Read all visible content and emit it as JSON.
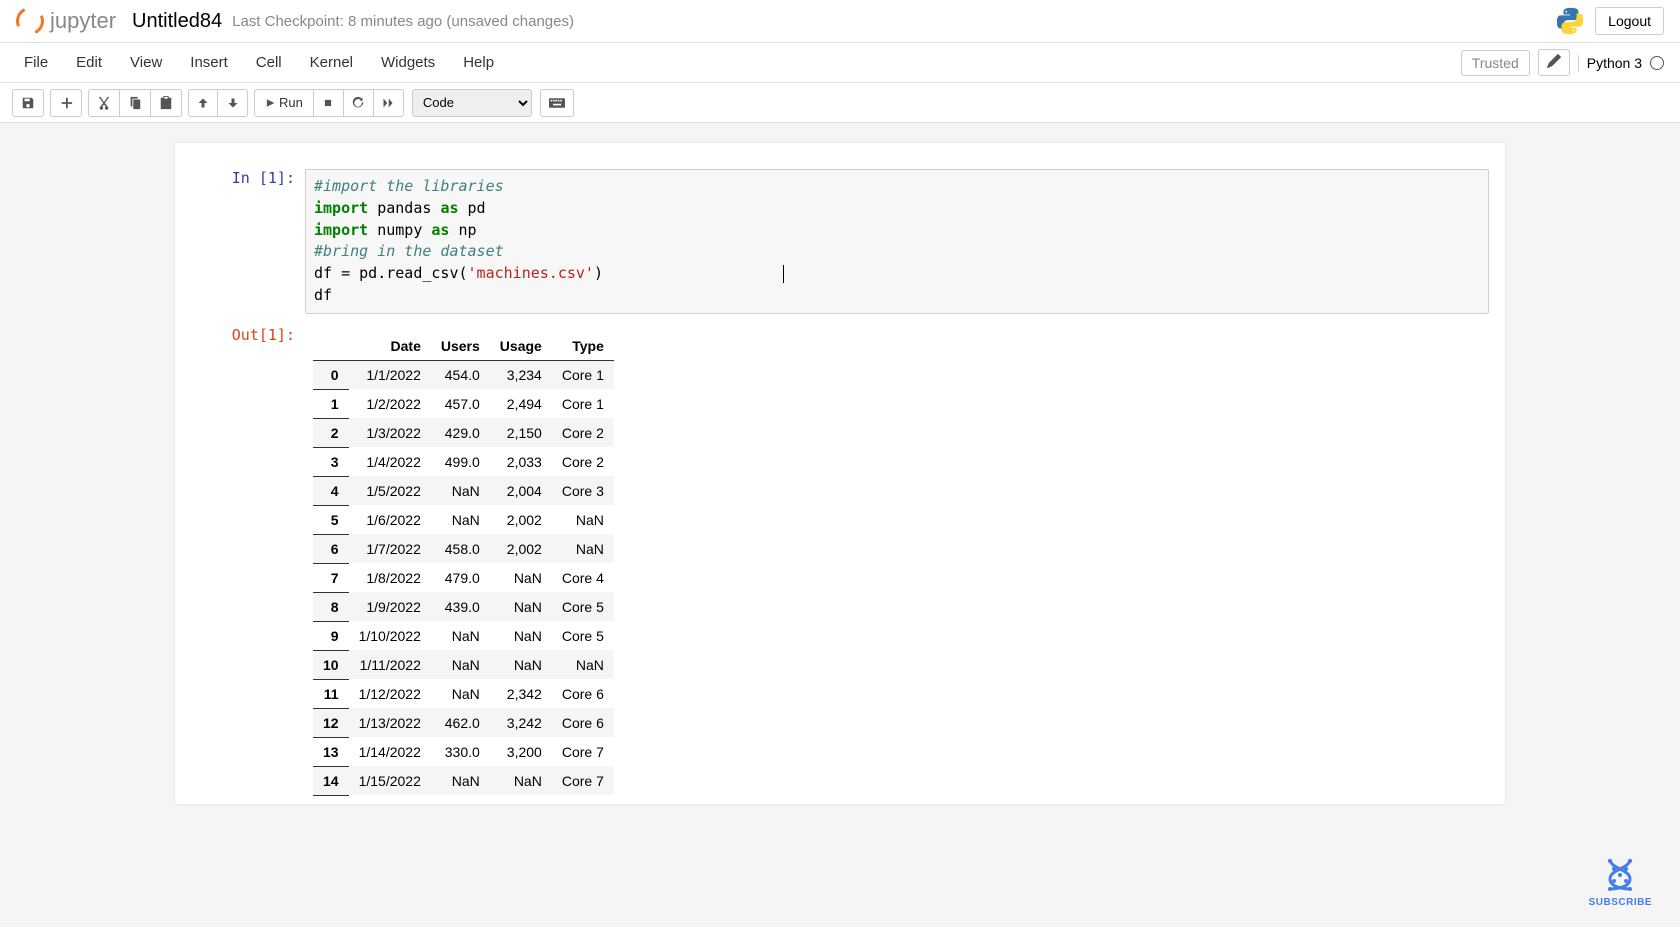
{
  "header": {
    "logo_text": "jupyter",
    "notebook_title": "Untitled84",
    "checkpoint_text": "Last Checkpoint: 8 minutes ago  (unsaved changes)",
    "logout_label": "Logout"
  },
  "menubar": {
    "items": [
      "File",
      "Edit",
      "View",
      "Insert",
      "Cell",
      "Kernel",
      "Widgets",
      "Help"
    ],
    "trusted_label": "Trusted",
    "kernel_name": "Python 3"
  },
  "toolbar": {
    "run_label": "Run",
    "celltype_selected": "Code"
  },
  "cell_in": {
    "prompt": "In [1]:",
    "code_lines": [
      {
        "type": "comment",
        "text": "#import the libraries"
      },
      {
        "type": "import1",
        "k1": "import",
        "p1": " pandas ",
        "k2": "as",
        "p2": " pd"
      },
      {
        "type": "import1",
        "k1": "import",
        "p1": " numpy ",
        "k2": "as",
        "p2": " np"
      },
      {
        "type": "comment",
        "text": "#bring in the dataset"
      },
      {
        "type": "read",
        "pre": "df = pd.read_csv(",
        "str": "'machines.csv'",
        "post": ")"
      },
      {
        "type": "plain",
        "text": "df"
      }
    ]
  },
  "cell_out": {
    "prompt": "Out[1]:",
    "columns": [
      "",
      "Date",
      "Users",
      "Usage",
      "Type"
    ],
    "rows": [
      [
        "0",
        "1/1/2022",
        "454.0",
        "3,234",
        "Core 1"
      ],
      [
        "1",
        "1/2/2022",
        "457.0",
        "2,494",
        "Core 1"
      ],
      [
        "2",
        "1/3/2022",
        "429.0",
        "2,150",
        "Core 2"
      ],
      [
        "3",
        "1/4/2022",
        "499.0",
        "2,033",
        "Core 2"
      ],
      [
        "4",
        "1/5/2022",
        "NaN",
        "2,004",
        "Core 3"
      ],
      [
        "5",
        "1/6/2022",
        "NaN",
        "2,002",
        "NaN"
      ],
      [
        "6",
        "1/7/2022",
        "458.0",
        "2,002",
        "NaN"
      ],
      [
        "7",
        "1/8/2022",
        "479.0",
        "NaN",
        "Core 4"
      ],
      [
        "8",
        "1/9/2022",
        "439.0",
        "NaN",
        "Core 5"
      ],
      [
        "9",
        "1/10/2022",
        "NaN",
        "NaN",
        "Core 5"
      ],
      [
        "10",
        "1/11/2022",
        "NaN",
        "NaN",
        "NaN"
      ],
      [
        "11",
        "1/12/2022",
        "NaN",
        "2,342",
        "Core 6"
      ],
      [
        "12",
        "1/13/2022",
        "462.0",
        "3,242",
        "Core 6"
      ],
      [
        "13",
        "1/14/2022",
        "330.0",
        "3,200",
        "Core 7"
      ],
      [
        "14",
        "1/15/2022",
        "NaN",
        "NaN",
        "Core 7"
      ]
    ]
  },
  "watermark": {
    "subscribe": "SUBSCRIBE"
  }
}
